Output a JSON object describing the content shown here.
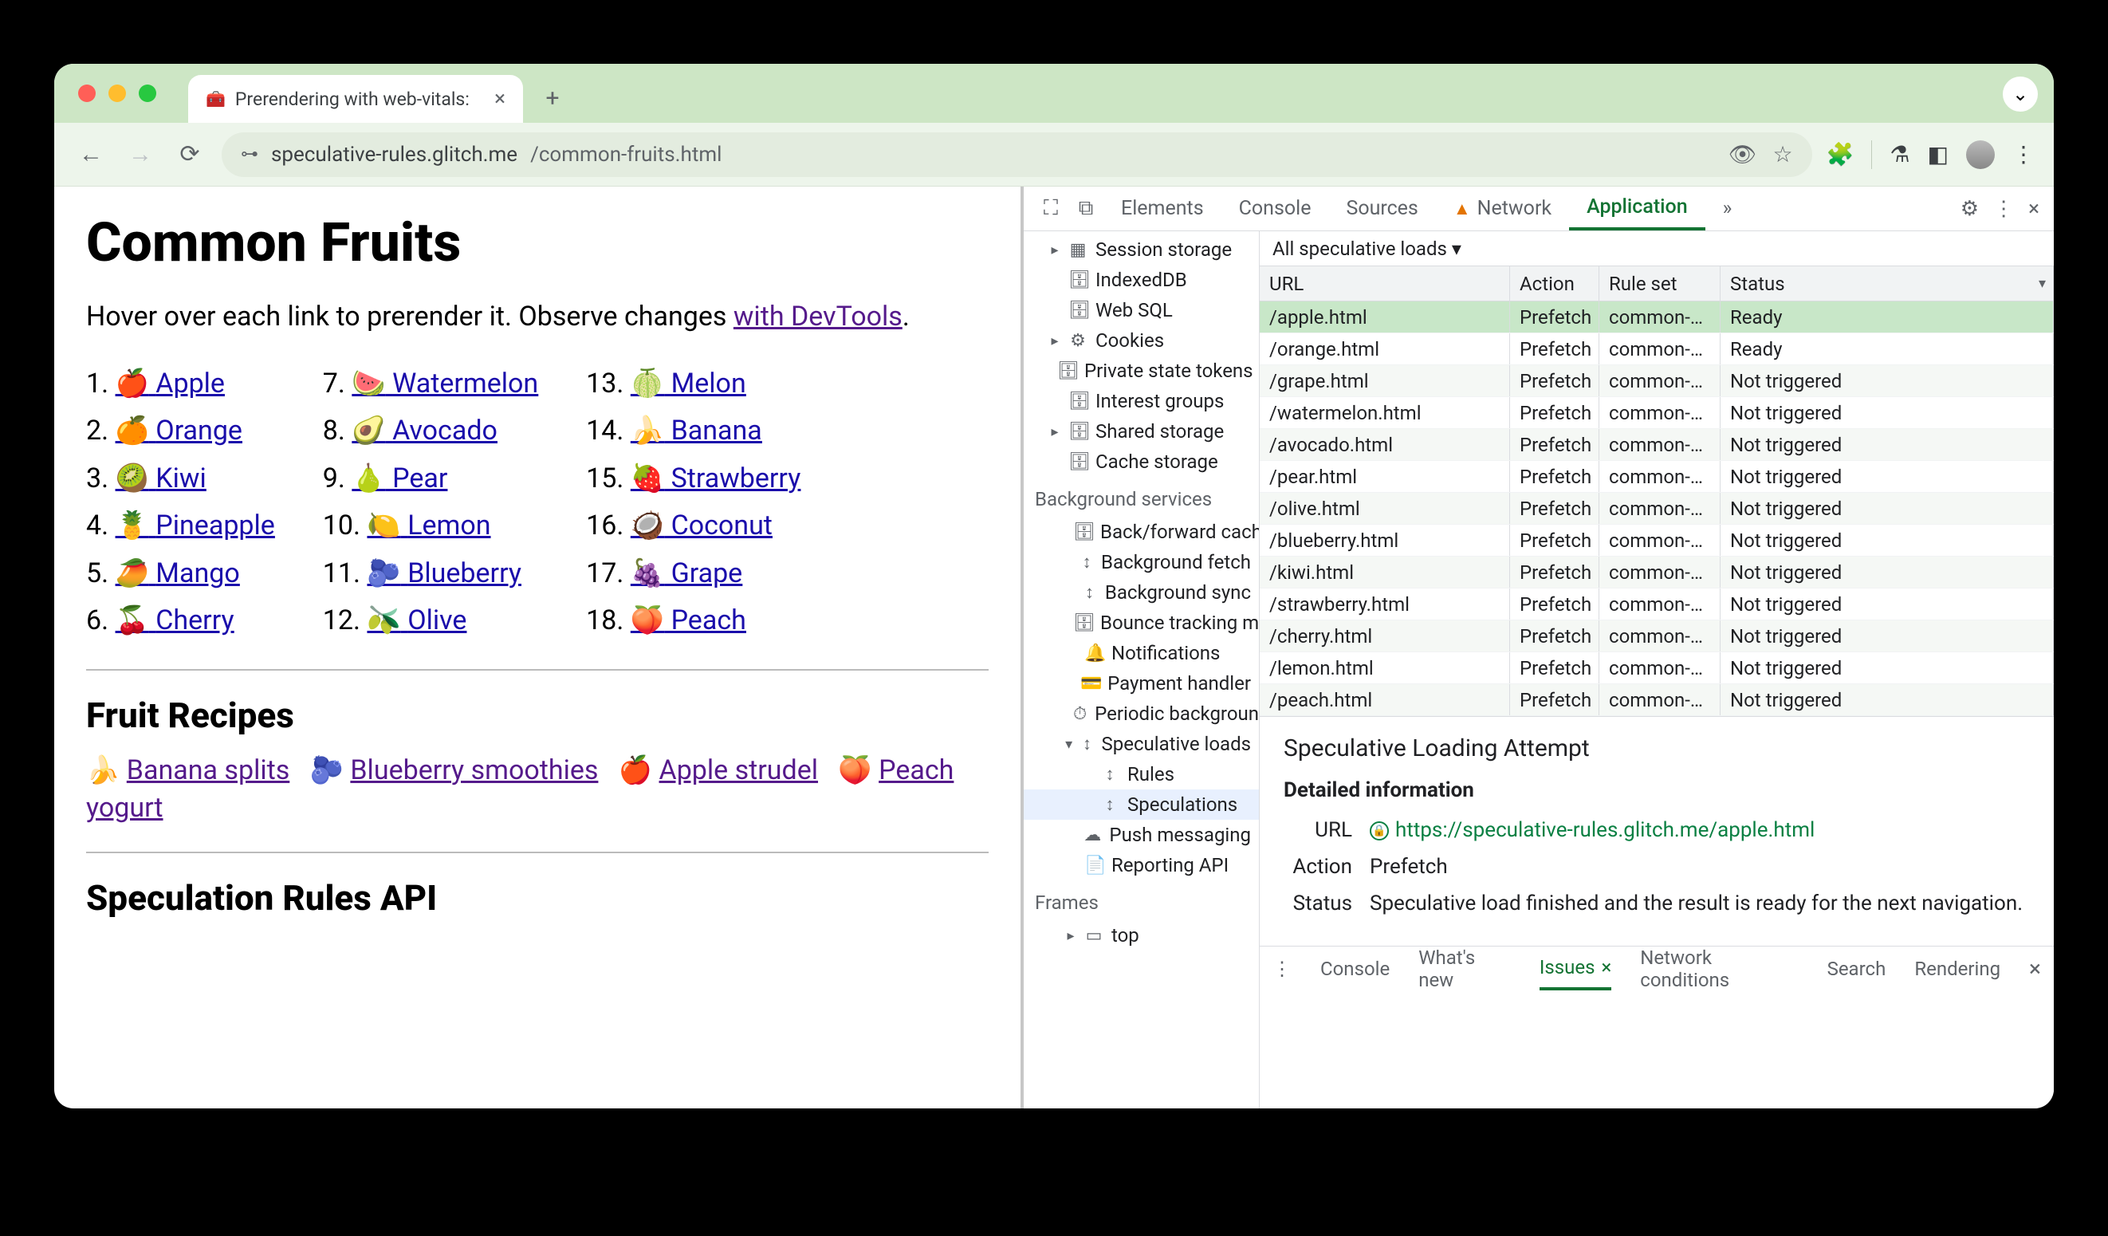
{
  "browser": {
    "tab_title": "Prerendering with web-vitals:",
    "tab_favicon": "🧰",
    "url_host": "speculative-rules.glitch.me",
    "url_path": "/common-fruits.html"
  },
  "page": {
    "h1": "Common Fruits",
    "intro_pre": "Hover over each link to prerender it. Observe changes ",
    "intro_link": "with DevTools",
    "intro_post": ".",
    "fruits_col1": [
      {
        "n": "1.",
        "e": "🍎",
        "t": "Apple"
      },
      {
        "n": "2.",
        "e": "🍊",
        "t": "Orange"
      },
      {
        "n": "3.",
        "e": "🥝",
        "t": "Kiwi"
      },
      {
        "n": "4.",
        "e": "🍍",
        "t": "Pineapple"
      },
      {
        "n": "5.",
        "e": "🥭",
        "t": "Mango"
      },
      {
        "n": "6.",
        "e": "🍒",
        "t": "Cherry"
      }
    ],
    "fruits_col2": [
      {
        "n": "7.",
        "e": "🍉",
        "t": "Watermelon"
      },
      {
        "n": "8.",
        "e": "🥑",
        "t": "Avocado"
      },
      {
        "n": "9.",
        "e": "🍐",
        "t": "Pear"
      },
      {
        "n": "10.",
        "e": "🍋",
        "t": "Lemon"
      },
      {
        "n": "11.",
        "e": "🫐",
        "t": "Blueberry"
      },
      {
        "n": "12.",
        "e": "🫒",
        "t": "Olive"
      }
    ],
    "fruits_col3": [
      {
        "n": "13.",
        "e": "🍈",
        "t": "Melon"
      },
      {
        "n": "14.",
        "e": "🍌",
        "t": "Banana"
      },
      {
        "n": "15.",
        "e": "🍓",
        "t": "Strawberry"
      },
      {
        "n": "16.",
        "e": "🥥",
        "t": "Coconut"
      },
      {
        "n": "17.",
        "e": "🍇",
        "t": "Grape"
      },
      {
        "n": "18.",
        "e": "🍑",
        "t": "Peach"
      }
    ],
    "h2_recipes": "Fruit Recipes",
    "recipes": [
      {
        "e": "🍌",
        "t": "Banana splits"
      },
      {
        "e": "🫐",
        "t": "Blueberry smoothies"
      },
      {
        "e": "🍎",
        "t": "Apple strudel"
      },
      {
        "e": "🍑",
        "t": "Peach yogurt"
      }
    ],
    "h2_api": "Speculation Rules API"
  },
  "devtools": {
    "tabs": [
      "Elements",
      "Console",
      "Sources",
      "Network",
      "Application"
    ],
    "active_tab": "Application",
    "network_warn": true,
    "more": "»",
    "tree_storage": [
      {
        "caret": "▸",
        "ico": "▦",
        "label": "Session storage"
      },
      {
        "caret": "",
        "ico": "🗄",
        "label": "IndexedDB"
      },
      {
        "caret": "",
        "ico": "🗄",
        "label": "Web SQL"
      },
      {
        "caret": "▸",
        "ico": "⚙",
        "label": "Cookies"
      },
      {
        "caret": "",
        "ico": "🗄",
        "label": "Private state tokens"
      },
      {
        "caret": "",
        "ico": "🗄",
        "label": "Interest groups"
      },
      {
        "caret": "▸",
        "ico": "🗄",
        "label": "Shared storage"
      },
      {
        "caret": "",
        "ico": "🗄",
        "label": "Cache storage"
      }
    ],
    "tree_bg_head": "Background services",
    "tree_bg": [
      {
        "ico": "🗄",
        "label": "Back/forward cache"
      },
      {
        "ico": "↕",
        "label": "Background fetch"
      },
      {
        "ico": "↕",
        "label": "Background sync"
      },
      {
        "ico": "🗄",
        "label": "Bounce tracking mitigation"
      },
      {
        "ico": "🔔",
        "label": "Notifications"
      },
      {
        "ico": "💳",
        "label": "Payment handler"
      },
      {
        "ico": "⏱",
        "label": "Periodic background"
      },
      {
        "ico": "↕",
        "label": "Speculative loads",
        "caret": "▾",
        "children": [
          {
            "ico": "↕",
            "label": "Rules"
          },
          {
            "ico": "↕",
            "label": "Speculations",
            "sel": true
          }
        ]
      },
      {
        "ico": "☁",
        "label": "Push messaging"
      },
      {
        "ico": "📄",
        "label": "Reporting API"
      }
    ],
    "tree_frames_head": "Frames",
    "tree_frames": [
      {
        "caret": "▸",
        "ico": "▭",
        "label": "top"
      }
    ],
    "filter_label": "All speculative loads",
    "cols": {
      "url": "URL",
      "action": "Action",
      "rule": "Rule set",
      "status": "Status"
    },
    "rows": [
      {
        "url": "/apple.html",
        "action": "Prefetch",
        "rule": "common-…",
        "status": "Ready",
        "sel": true
      },
      {
        "url": "/orange.html",
        "action": "Prefetch",
        "rule": "common-…",
        "status": "Ready"
      },
      {
        "url": "/grape.html",
        "action": "Prefetch",
        "rule": "common-…",
        "status": "Not triggered"
      },
      {
        "url": "/watermelon.html",
        "action": "Prefetch",
        "rule": "common-…",
        "status": "Not triggered"
      },
      {
        "url": "/avocado.html",
        "action": "Prefetch",
        "rule": "common-…",
        "status": "Not triggered"
      },
      {
        "url": "/pear.html",
        "action": "Prefetch",
        "rule": "common-…",
        "status": "Not triggered"
      },
      {
        "url": "/olive.html",
        "action": "Prefetch",
        "rule": "common-…",
        "status": "Not triggered"
      },
      {
        "url": "/blueberry.html",
        "action": "Prefetch",
        "rule": "common-…",
        "status": "Not triggered"
      },
      {
        "url": "/kiwi.html",
        "action": "Prefetch",
        "rule": "common-…",
        "status": "Not triggered"
      },
      {
        "url": "/strawberry.html",
        "action": "Prefetch",
        "rule": "common-…",
        "status": "Not triggered"
      },
      {
        "url": "/cherry.html",
        "action": "Prefetch",
        "rule": "common-…",
        "status": "Not triggered"
      },
      {
        "url": "/lemon.html",
        "action": "Prefetch",
        "rule": "common-…",
        "status": "Not triggered"
      },
      {
        "url": "/peach.html",
        "action": "Prefetch",
        "rule": "common-…",
        "status": "Not triggered"
      }
    ],
    "detail": {
      "title": "Speculative Loading Attempt",
      "subhead": "Detailed information",
      "url_k": "URL",
      "url_v": "https://speculative-rules.glitch.me/apple.html",
      "action_k": "Action",
      "action_v": "Prefetch",
      "status_k": "Status",
      "status_v": "Speculative load finished and the result is ready for the next navigation."
    },
    "drawer": [
      "Console",
      "What's new",
      "Issues",
      "Network conditions",
      "Search",
      "Rendering"
    ],
    "drawer_active": "Issues"
  }
}
